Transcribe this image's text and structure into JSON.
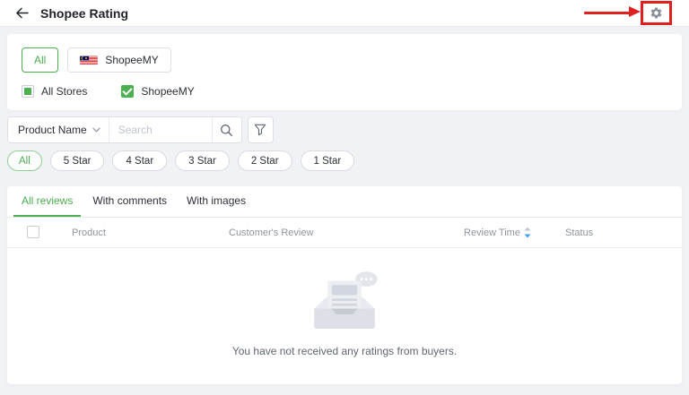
{
  "header": {
    "title": "Shopee Rating"
  },
  "store_panel": {
    "tabs": [
      {
        "label": "All",
        "active": true
      },
      {
        "label": "ShopeeMY",
        "active": false
      }
    ],
    "checks": [
      {
        "label": "All Stores",
        "state": "indeterminate"
      },
      {
        "label": "ShopeeMY",
        "state": "checked"
      }
    ]
  },
  "filter_bar": {
    "category": "Product Name",
    "search_placeholder": "Search"
  },
  "star_filters": {
    "all": "All",
    "s5": "5 Star",
    "s4": "4 Star",
    "s3": "3 Star",
    "s2": "2 Star",
    "s1": "1 Star"
  },
  "tabs": {
    "all": "All reviews",
    "comments": "With comments",
    "images": "With images"
  },
  "table": {
    "col_product": "Product",
    "col_review": "Customer's Review",
    "col_time": "Review Time",
    "col_status": "Status"
  },
  "empty": {
    "message": "You have not received any ratings from buyers."
  },
  "icons": {
    "back": "arrow-left",
    "settings": "gear",
    "search": "magnifier",
    "filter": "funnel",
    "category_caret": "chevron-down",
    "sort": "sort-arrows-desc-active",
    "store_flag": "malaysia-flag",
    "empty_state": "inbox-with-dots-bubble"
  },
  "colors": {
    "accent_green": "#4caf50",
    "annotation_red": "#e02020",
    "sort_active_blue": "#409eff",
    "page_background": "#f0f2f5"
  }
}
